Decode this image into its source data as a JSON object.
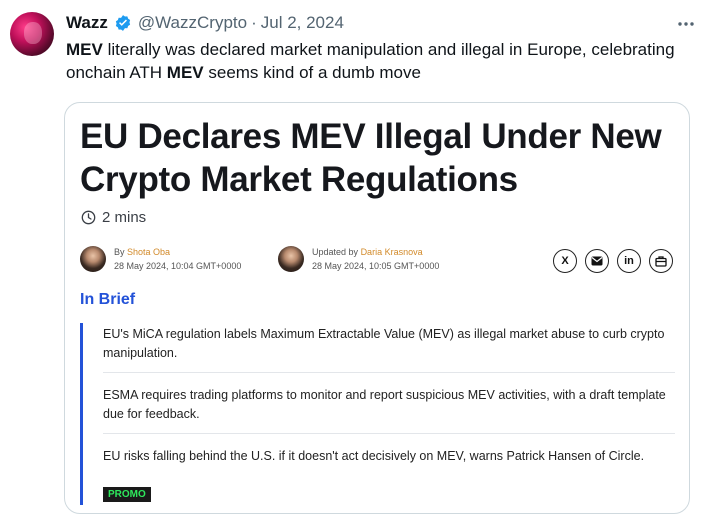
{
  "tweet": {
    "author_name": "Wazz",
    "handle": "@WazzCrypto",
    "separator": "·",
    "date": "Jul 2, 2024",
    "text_segments": {
      "s1_bold": "MEV",
      "s1_rest": " literally was declared market manipulation and illegal in Europe, celebrating onchain ATH ",
      "s2_bold": "MEV",
      "s2_rest": " seems kind of a dumb move"
    },
    "icons": {
      "verified": "verified-badge-icon",
      "more": "more-horizontal-icon"
    },
    "accent": "#1d9bf0"
  },
  "card": {
    "headline": "EU Declares MEV Illegal Under New Crypto Market Regulations",
    "read_time": "2 mins",
    "authors": [
      {
        "label": "By",
        "name": "Shota Oba",
        "datetime": "28 May 2024, 10:04 GMT+0000"
      },
      {
        "label": "Updated by",
        "name": "Daria Krasnova",
        "datetime": "28 May 2024, 10:05 GMT+0000"
      }
    ],
    "share_icons": [
      "x-icon",
      "mail-icon",
      "linkedin-icon",
      "copy-link-icon"
    ],
    "share_labels": {
      "x": "X",
      "linkedin": "in"
    },
    "in_brief": {
      "title": "In Brief",
      "items": [
        "EU's MiCA regulation labels Maximum Extractable Value (MEV) as illegal market abuse to curb crypto manipulation.",
        "ESMA requires trading platforms to monitor and report suspicious MEV activities, with a draft template due for feedback.",
        "EU risks falling behind the U.S. if it doesn't act decisively on MEV, warns Patrick Hansen of Circle."
      ],
      "promo": "PROMO"
    },
    "colors": {
      "brief_accent": "#2352d8",
      "author_link": "#d28a2a",
      "promo_text": "#2ee85c"
    }
  }
}
